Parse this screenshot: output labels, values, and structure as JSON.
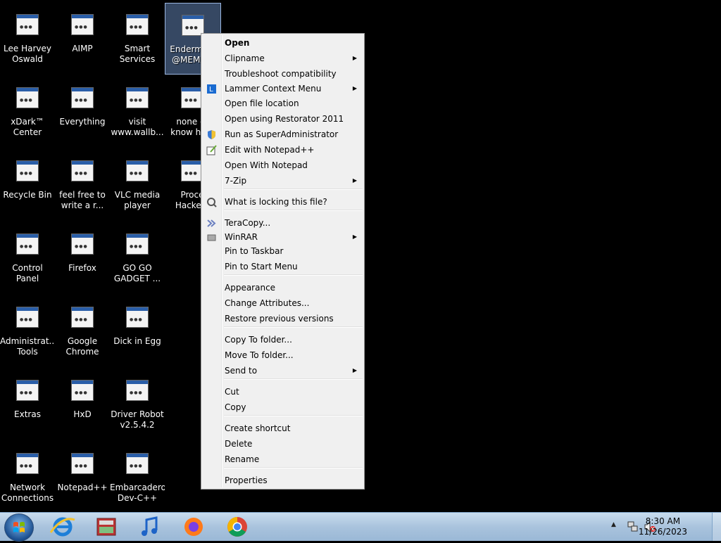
{
  "desktop": {
    "icons": [
      {
        "label": "Lee Harvey\nOswald",
        "icon": "anime-character-icon"
      },
      {
        "label": "AIMP",
        "icon": "aimp-icon"
      },
      {
        "label": "Smart\nServices",
        "icon": "gear-icon"
      },
      {
        "label": "Enderma...\n@MEMZ...",
        "icon": "exe-icon"
      },
      {
        "label": "xDark™\nCenter",
        "icon": "xdark-icon"
      },
      {
        "label": "Everything",
        "icon": "everything-icon"
      },
      {
        "label": "visit\nwww.wallb...",
        "icon": "text-file-icon"
      },
      {
        "label": "none of\nknow ho...",
        "icon": "exe-icon"
      },
      {
        "label": "Recycle Bin",
        "icon": "recycle-bin-icon"
      },
      {
        "label": "feel free to\nwrite a r...",
        "icon": "text-file-icon"
      },
      {
        "label": "VLC media\nplayer",
        "icon": "vlc-icon"
      },
      {
        "label": "Proce\nHacke...",
        "icon": "process-hacker-icon"
      },
      {
        "label": "Control Panel",
        "icon": "control-panel-icon"
      },
      {
        "label": "Firefox",
        "icon": "firefox-icon"
      },
      {
        "label": "GO GO\nGADGET ...",
        "icon": "folder-icon"
      },
      {
        "label": "Administrat...\nTools",
        "icon": "admin-tools-icon"
      },
      {
        "label": "Google\nChrome",
        "icon": "chrome-icon"
      },
      {
        "label": "Dick in Egg",
        "icon": "exe-icon"
      },
      {
        "label": "Extras",
        "icon": "folder-icon"
      },
      {
        "label": "HxD",
        "icon": "hxd-icon"
      },
      {
        "label": "Driver Robot\nv2.5.4.2",
        "icon": "driver-robot-icon"
      },
      {
        "label": "Network\nConnections",
        "icon": "network-icon"
      },
      {
        "label": "Notepad++",
        "icon": "notepadpp-icon"
      },
      {
        "label": "Embarcadero\nDev-C++",
        "icon": "devcpp-icon"
      }
    ]
  },
  "context_menu": {
    "items": [
      {
        "label": "Open",
        "bold": true
      },
      {
        "label": "Clipname",
        "submenu": true
      },
      {
        "label": "Troubleshoot compatibility"
      },
      {
        "label": "Lammer Context Menu",
        "submenu": true,
        "icon": "lammer-icon"
      },
      {
        "label": "Open file location"
      },
      {
        "label": "Open using Restorator 2011"
      },
      {
        "label": "Run as SuperAdministrator",
        "icon": "shield-icon"
      },
      {
        "label": "Edit with Notepad++",
        "icon": "notepadpp-icon"
      },
      {
        "label": "Open With Notepad"
      },
      {
        "label": "7-Zip",
        "submenu": true
      },
      {
        "label": "What is locking this file?",
        "icon": "magnifier-gear-icon"
      },
      {
        "label": "TeraCopy...",
        "icon": "teracopy-icon"
      },
      {
        "label": "WinRAR",
        "submenu": true,
        "icon": "winrar-icon"
      },
      {
        "label": "Pin to Taskbar"
      },
      {
        "label": "Pin to Start Menu"
      },
      {
        "label": "Appearance"
      },
      {
        "label": "Change Attributes..."
      },
      {
        "label": "Restore previous versions"
      },
      {
        "label": "Copy To folder..."
      },
      {
        "label": "Move To folder..."
      },
      {
        "label": "Send to",
        "submenu": true
      },
      {
        "label": "Cut"
      },
      {
        "label": "Copy"
      },
      {
        "label": "Create shortcut"
      },
      {
        "label": "Delete"
      },
      {
        "label": "Rename"
      },
      {
        "label": "Properties"
      }
    ],
    "arrow_glyph": "▶"
  },
  "taskbar": {
    "pinned": [
      "start-orb-icon",
      "internet-explorer-icon",
      "archive-app-icon",
      "music-icon",
      "firefox-icon",
      "chrome-icon"
    ],
    "tray": {
      "time": "8:30 AM",
      "date": "11/26/2023",
      "icons": [
        "show-hidden-icons-chevron",
        "network-icon",
        "volume-muted-icon"
      ]
    }
  },
  "colors": {
    "menu_bg": "#f0f0f0",
    "taskbar": "#a9c3dd",
    "selection": "#78a0dc"
  }
}
